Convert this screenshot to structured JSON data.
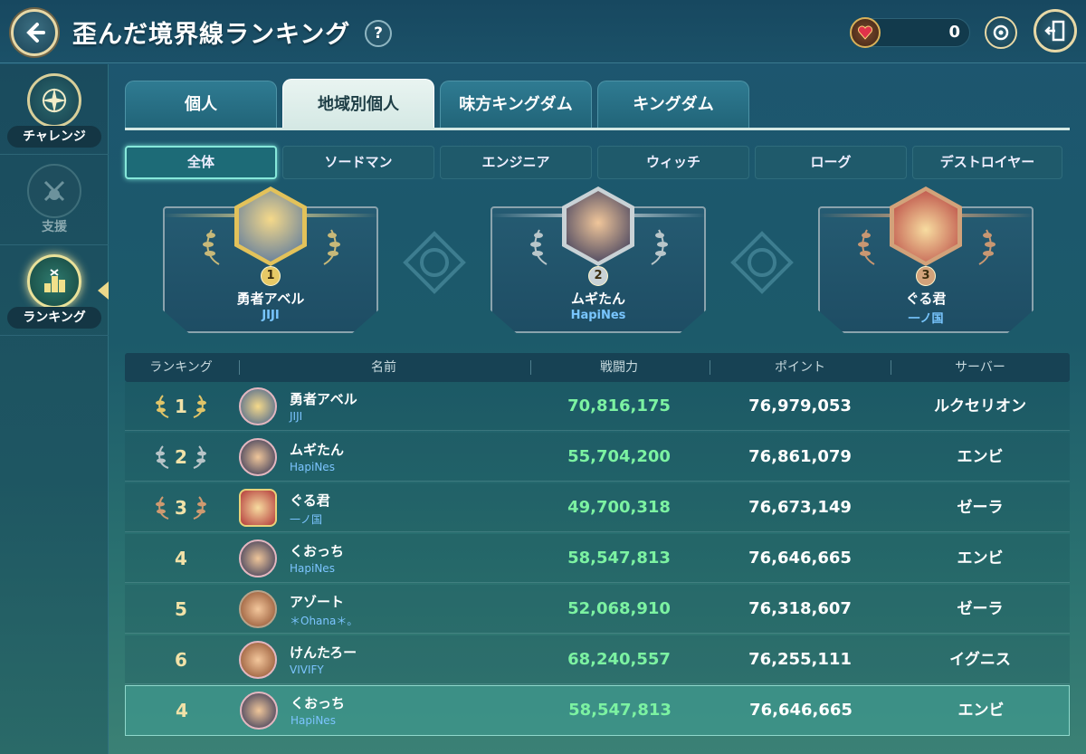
{
  "header": {
    "title": "歪んだ境界線ランキング",
    "help": "?",
    "currency_value": "0"
  },
  "sidebar": {
    "items": [
      {
        "label": "チャレンジ"
      },
      {
        "label": "支援"
      },
      {
        "label": "ランキング"
      }
    ]
  },
  "tabs": [
    "個人",
    "地域別個人",
    "味方キングダム",
    "キングダム"
  ],
  "filters": [
    "全体",
    "ソードマン",
    "エンジニア",
    "ウィッチ",
    "ローグ",
    "デストロイヤー"
  ],
  "podium": [
    {
      "rank": "1",
      "name": "勇者アベル",
      "guild": "JIJI"
    },
    {
      "rank": "2",
      "name": "ムギたん",
      "guild": "HapiNes"
    },
    {
      "rank": "3",
      "name": "ぐる君",
      "guild": "一ノ国"
    }
  ],
  "table": {
    "headers": [
      "ランキング",
      "名前",
      "戦闘力",
      "ポイント",
      "サーバー"
    ],
    "rows": [
      {
        "rank": "1",
        "name": "勇者アベル",
        "guild": "JIJI",
        "power": "70,816,175",
        "points": "76,979,053",
        "server": "ルクセリオン"
      },
      {
        "rank": "2",
        "name": "ムギたん",
        "guild": "HapiNes",
        "power": "55,704,200",
        "points": "76,861,079",
        "server": "エンビ"
      },
      {
        "rank": "3",
        "name": "ぐる君",
        "guild": "一ノ国",
        "power": "49,700,318",
        "points": "76,673,149",
        "server": "ゼーラ"
      },
      {
        "rank": "4",
        "name": "くおっち",
        "guild": "HapiNes",
        "power": "58,547,813",
        "points": "76,646,665",
        "server": "エンビ"
      },
      {
        "rank": "5",
        "name": "アゾート",
        "guild": "＊Ohana＊。",
        "power": "52,068,910",
        "points": "76,318,607",
        "server": "ゼーラ"
      },
      {
        "rank": "6",
        "name": "けんたろー",
        "guild": "VIVIFY",
        "power": "68,240,557",
        "points": "76,255,111",
        "server": "イグニス"
      }
    ],
    "self_row": {
      "rank": "4",
      "name": "くおっち",
      "guild": "HapiNes",
      "power": "58,547,813",
      "points": "76,646,665",
      "server": "エンビ"
    }
  }
}
